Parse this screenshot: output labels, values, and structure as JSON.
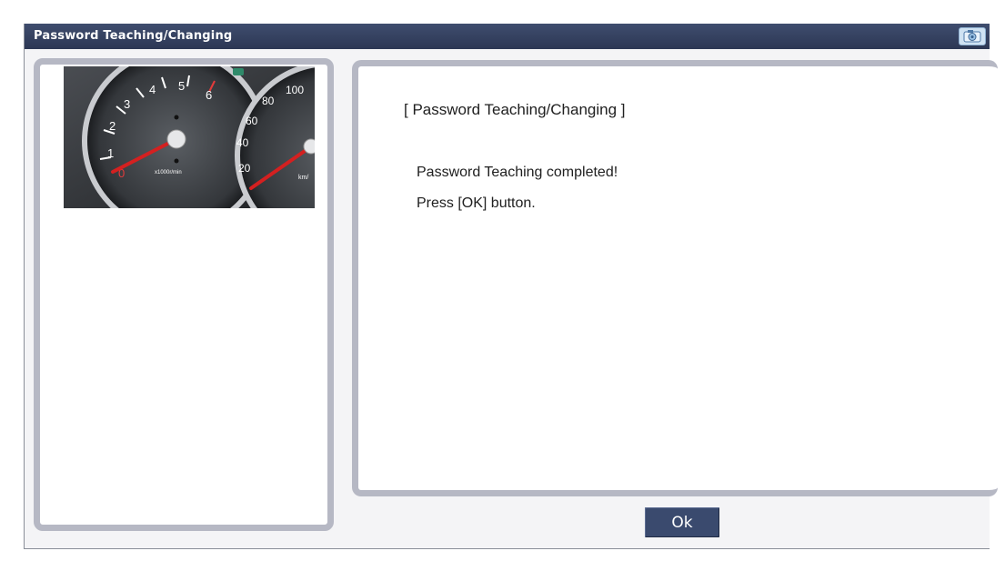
{
  "window": {
    "title": "Password Teaching/Changing"
  },
  "left_panel": {
    "image_alt": "instrument-cluster-gauges",
    "tachometer_ticks": [
      "0",
      "1",
      "2",
      "3",
      "4",
      "5",
      "6"
    ],
    "tachometer_unit": "x1000r/min",
    "speedometer_ticks": [
      "20",
      "40",
      "60",
      "80",
      "100"
    ],
    "speedometer_unit": "km/"
  },
  "message": {
    "heading": "[ Password Teaching/Changing ]",
    "line1": "Password Teaching completed!",
    "line2": "Press [OK] button."
  },
  "buttons": {
    "ok_label": "Ok"
  },
  "icons": {
    "title_icon": "camera-icon"
  },
  "colors": {
    "titlebar": "#2f3a58",
    "panel_border": "#b6b8c4",
    "button": "#3a4a6e",
    "needle": "#d42020"
  }
}
